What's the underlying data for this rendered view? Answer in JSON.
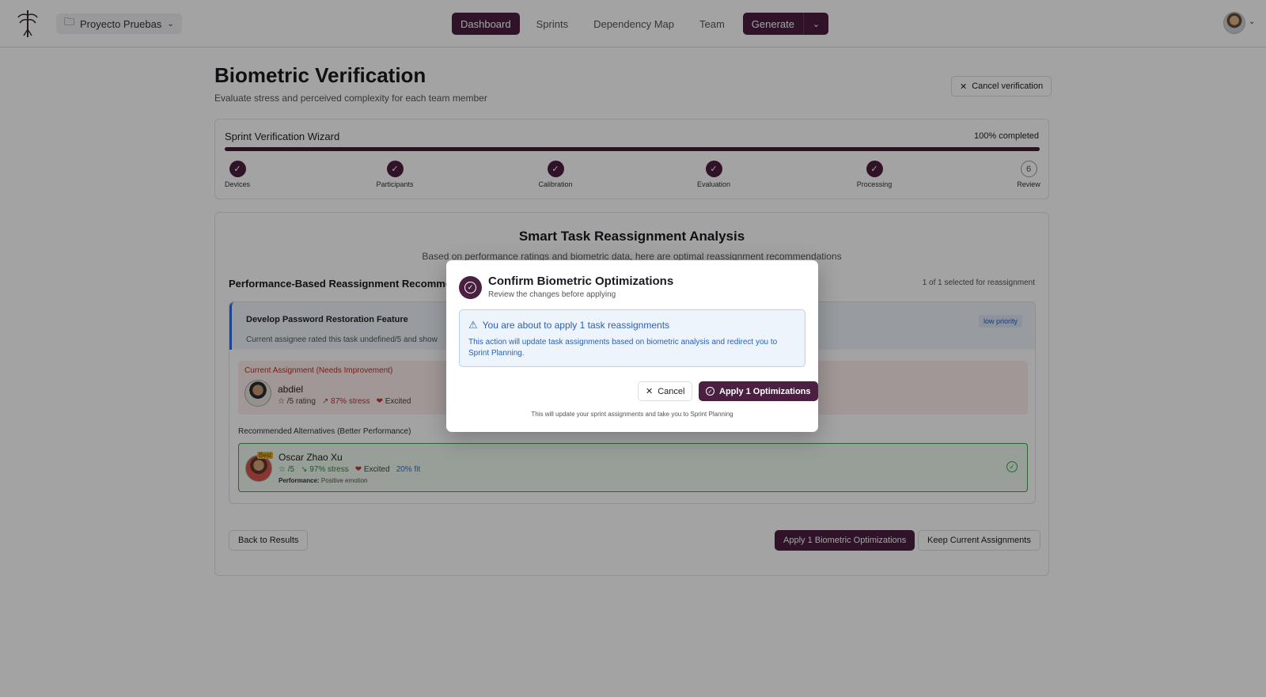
{
  "header": {
    "project": "Proyecto Pruebas",
    "nav": [
      "Dashboard",
      "Sprints",
      "Dependency Map",
      "Team"
    ],
    "active_nav": "Dashboard",
    "generate": "Generate"
  },
  "page": {
    "title": "Biometric Verification",
    "subtitle": "Evaluate stress and perceived complexity for each team member",
    "cancel_verification": "Cancel verification"
  },
  "wizard": {
    "title": "Sprint Verification Wizard",
    "progress_text": "100% completed",
    "progress": 1.0,
    "steps": [
      {
        "label": "Devices",
        "mark": "✓"
      },
      {
        "label": "Participants",
        "mark": "✓"
      },
      {
        "label": "Calibration",
        "mark": "✓"
      },
      {
        "label": "Evaluation",
        "mark": "✓"
      },
      {
        "label": "Processing",
        "mark": "✓"
      },
      {
        "label": "Review",
        "mark": "6"
      }
    ]
  },
  "analysis": {
    "title": "Smart Task Reassignment Analysis",
    "subtitle": "Based on performance ratings and biometric data, here are optimal reassignment recommendations",
    "section_title": "Performance-Based Reassignment Recomme",
    "selected_count": "1 of 1 selected for reassignment",
    "task": {
      "name": "Develop Password Restoration Feature",
      "description": "Current assignee rated this task undefined/5 and show",
      "priority": "low priority"
    },
    "current": {
      "title": "Current Assignment (Needs Improvement)",
      "name": "abdiel",
      "rating": "☆ /5 rating",
      "stress": "↗ 87% stress",
      "emotion": "Excited"
    },
    "recommended_title": "Recommended Alternatives (Better Performance)",
    "recommended": {
      "badge": "Best",
      "name": "Oscar Zhao Xu",
      "rating": "☆ /5",
      "stress": "↘ 97% stress",
      "emotion": "Excited",
      "fit": "20% fit",
      "performance_label": "Performance:",
      "performance_value": "Positive emotion"
    },
    "back": "Back to Results",
    "apply": "Apply 1 Biometric Optimizations",
    "keep": "Keep Current Assignments"
  },
  "modal": {
    "title": "Confirm Biometric Optimizations",
    "subtitle": "Review the changes before applying",
    "info_title": "You are about to apply 1 task reassignments",
    "info_body": "This action will update task assignments based on biometric analysis and redirect you to Sprint Planning.",
    "cancel": "Cancel",
    "apply": "Apply 1 Optimizations",
    "footer": "This will update your sprint assignments and take you to Sprint Planning"
  },
  "colors": {
    "brand": "#4b1f3f",
    "info_blue": "#2a5fb8",
    "success": "#3ea24a",
    "danger": "#c5332c"
  }
}
